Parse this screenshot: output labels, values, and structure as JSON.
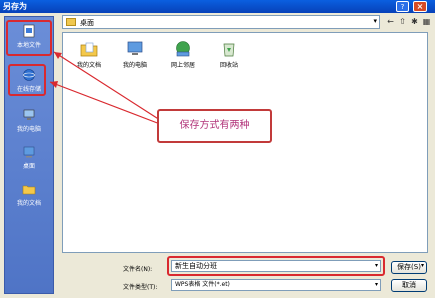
{
  "window": {
    "title": "另存为",
    "help_glyph": "?",
    "close_glyph": "×"
  },
  "sidebar": {
    "items": [
      {
        "label": "本地文件",
        "icon": "local-file-icon"
      },
      {
        "label": "在线存储",
        "icon": "online-storage-icon"
      },
      {
        "label": "我的电脑",
        "icon": "computer-icon"
      },
      {
        "label": "桌面",
        "icon": "desktop-icon"
      },
      {
        "label": "我的文档",
        "icon": "documents-folder-icon"
      }
    ]
  },
  "lookin": {
    "value": "桌面",
    "arrow": "▾"
  },
  "toolbar": {
    "back": "←",
    "up": "⇧",
    "new_folder": "✱",
    "views": "▦"
  },
  "files": [
    {
      "label": "我的文档",
      "icon": "documents-folder-icon"
    },
    {
      "label": "我的电脑",
      "icon": "computer-icon"
    },
    {
      "label": "网上邻居",
      "icon": "network-icon"
    },
    {
      "label": "回收站",
      "icon": "recycle-bin-icon"
    }
  ],
  "callout": {
    "text": "保存方式有两种"
  },
  "bottom": {
    "filename_label": "文件名(N):",
    "filename_value": "新生自动分班",
    "filetype_label": "文件类型(T):",
    "filetype_value": "WPS表格 文件(*.et)",
    "combo_arrow": "▾",
    "save_label": "保存(S)",
    "save_arrow": "▾",
    "cancel_label": "取消"
  },
  "colors": {
    "annotation_red": "#D9292F",
    "callout_text": "#B2347A",
    "titlebar": "#0A5FE0"
  }
}
